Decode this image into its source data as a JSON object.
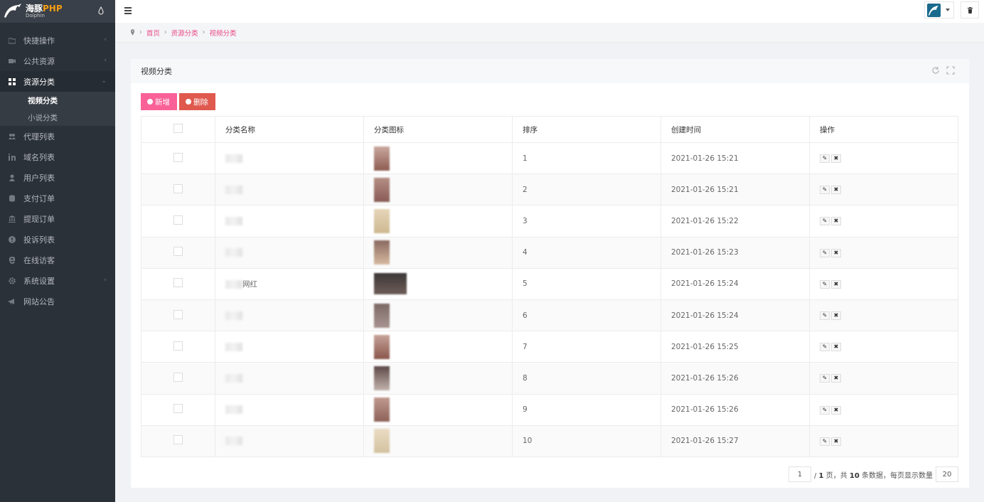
{
  "brand": {
    "name": "海豚",
    "suffix": "PHP",
    "sub": "Dolphin"
  },
  "sidebar": {
    "items": [
      {
        "label": "快捷操作",
        "icon": "folder-icon",
        "chevron": "‹"
      },
      {
        "label": "公共资源",
        "icon": "video-icon",
        "chevron": "‹"
      },
      {
        "label": "资源分类",
        "icon": "grid-icon",
        "chevron": "⌄"
      },
      {
        "label": "代理列表",
        "icon": "users-icon"
      },
      {
        "label": "域名列表",
        "icon": "linkedin-icon"
      },
      {
        "label": "用户列表",
        "icon": "user-icon"
      },
      {
        "label": "支付订单",
        "icon": "database-icon"
      },
      {
        "label": "提现订单",
        "icon": "bank-icon"
      },
      {
        "label": "投诉列表",
        "icon": "alert-icon"
      },
      {
        "label": "在线访客",
        "icon": "ie-icon"
      },
      {
        "label": "系统设置",
        "icon": "gear-icon",
        "chevron": "‹"
      },
      {
        "label": "网站公告",
        "icon": "bullhorn-icon"
      }
    ],
    "sub_items": [
      {
        "label": "视频分类"
      },
      {
        "label": "小说分类"
      }
    ]
  },
  "breadcrumb": {
    "home": "首页",
    "level1": "资源分类",
    "level2": "视频分类"
  },
  "panel": {
    "title": "视频分类"
  },
  "toolbar": {
    "add_label": "新增",
    "delete_label": "删除"
  },
  "table": {
    "headers": [
      "分类名称",
      "分类图标",
      "排序",
      "创建时间",
      "操作"
    ],
    "rows": [
      {
        "name": "",
        "sort": "1",
        "time": "2021-01-26 15:21"
      },
      {
        "name": "",
        "sort": "2",
        "time": "2021-01-26 15:21"
      },
      {
        "name": "",
        "sort": "3",
        "time": "2021-01-26 15:22"
      },
      {
        "name": "",
        "sort": "4",
        "time": "2021-01-26 15:23"
      },
      {
        "name": "网红",
        "sort": "5",
        "time": "2021-01-26 15:24"
      },
      {
        "name": "",
        "sort": "6",
        "time": "2021-01-26 15:24"
      },
      {
        "name": "",
        "sort": "7",
        "time": "2021-01-26 15:25"
      },
      {
        "name": "",
        "sort": "8",
        "time": "2021-01-26 15:26"
      },
      {
        "name": "",
        "sort": "9",
        "time": "2021-01-26 15:26"
      },
      {
        "name": "",
        "sort": "10",
        "time": "2021-01-26 15:27"
      }
    ]
  },
  "pager": {
    "page": "1",
    "total_pages": "1",
    "label_page": "页，共",
    "total": "10",
    "label_total": "条数据，每页显示数量",
    "page_size": "20"
  },
  "colors": {
    "accent": "#f96197",
    "danger": "#e0594e",
    "sidebar": "#2b3138",
    "link": "#e84a84"
  }
}
